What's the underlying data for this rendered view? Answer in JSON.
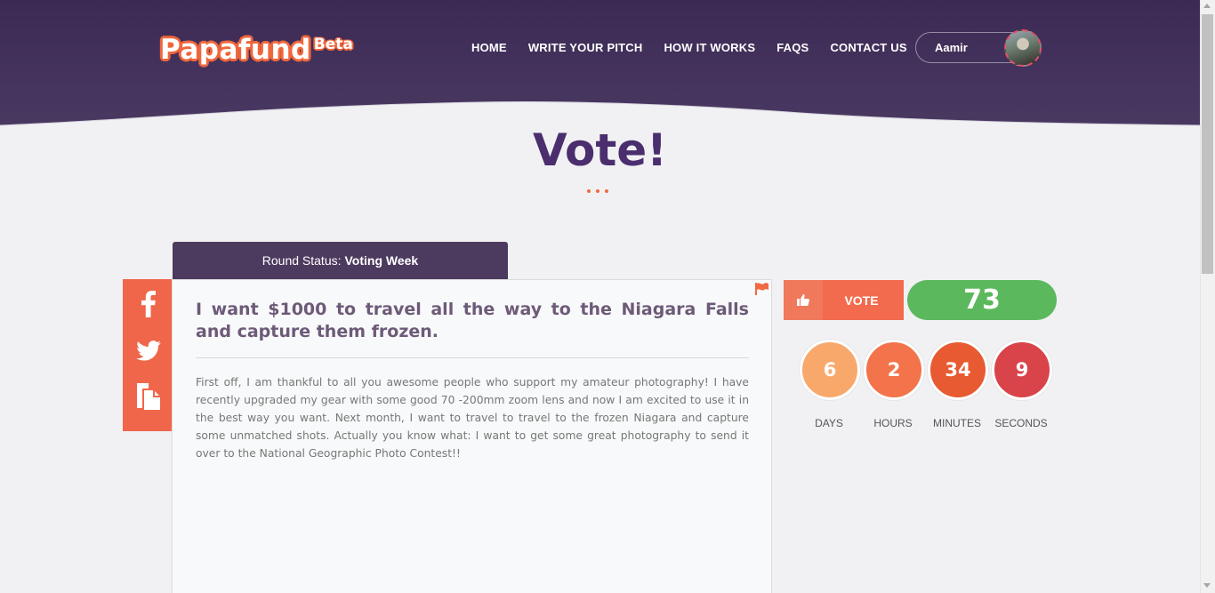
{
  "brand": {
    "name": "Papafund",
    "badge": "Beta"
  },
  "nav": [
    {
      "label": "HOME"
    },
    {
      "label": "WRITE YOUR PITCH"
    },
    {
      "label": "HOW IT WORKS"
    },
    {
      "label": "FAQS"
    },
    {
      "label": "CONTACT US"
    }
  ],
  "user": {
    "name": "Aamir"
  },
  "page": {
    "title": "Vote!"
  },
  "round": {
    "prefix": "Round Status:",
    "status": "Voting Week"
  },
  "share": {
    "icons": [
      "facebook-icon",
      "twitter-icon",
      "copy-icon"
    ]
  },
  "pitch": {
    "title": "I want $1000 to travel all the way to the Niagara Falls and capture them frozen.",
    "body": "First off, I am thankful to all you awesome people who support my amateur photography! I have recently upgraded my gear with some good 70 -200mm zoom lens and now I am excited to use it in the best way you want. Next month, I want to travel to travel to the frozen Niagara and capture some unmatched shots. Actually you know what: I want to get some great photography to send it over to the National Geographic Photo Contest!!"
  },
  "vote": {
    "label": "VOTE",
    "count": "73"
  },
  "countdown": [
    {
      "value": "6",
      "label": "DAYS",
      "color": "#f9a86c"
    },
    {
      "value": "2",
      "label": "HOURS",
      "color": "#f3734a"
    },
    {
      "value": "34",
      "label": "MINUTES",
      "color": "#e85a32"
    },
    {
      "value": "9",
      "label": "SECONDS",
      "color": "#d9434a"
    }
  ],
  "colors": {
    "header": "#3c2a55",
    "accent": "#f06a43",
    "vote_green": "#5cb85c",
    "title": "#4a2e6e"
  }
}
